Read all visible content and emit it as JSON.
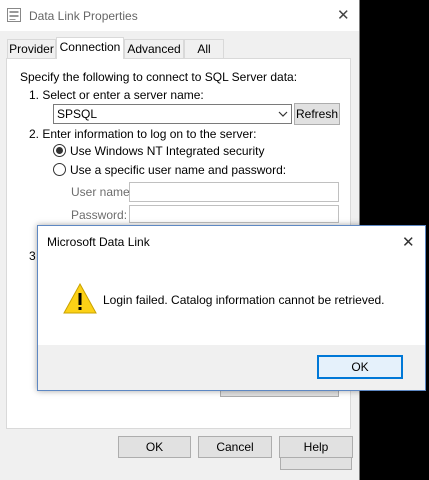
{
  "main_window": {
    "title": "Data Link Properties",
    "close_glyph": "✕",
    "tabs": [
      {
        "label": "Provider"
      },
      {
        "label": "Connection"
      },
      {
        "label": "Advanced"
      },
      {
        "label": "All"
      }
    ],
    "active_tab": "Connection",
    "connection": {
      "intro": "Specify the following to connect to SQL Server data:",
      "step1": "1. Select or enter a server name:",
      "server_value": "SPSQL",
      "refresh_label": "Refresh",
      "step2": "2. Enter information to log on to the server:",
      "radio_nt_label": "Use Windows NT Integrated security",
      "radio_specific_label": "Use a specific user name and password:",
      "user_name_label": "User name:",
      "password_label": "Password:",
      "step3_partial": "3"
    },
    "footer": {
      "ok_label": "OK",
      "cancel_label": "Cancel",
      "help_label": "Help"
    }
  },
  "dialog": {
    "title": "Microsoft Data Link",
    "close_glyph": "✕",
    "message": "Login failed. Catalog information cannot be retrieved.",
    "ok_label": "OK"
  },
  "colors": {
    "dialog_border": "#5e88c3",
    "focus_border": "#0078d7",
    "warning_fill": "#fcd116"
  }
}
